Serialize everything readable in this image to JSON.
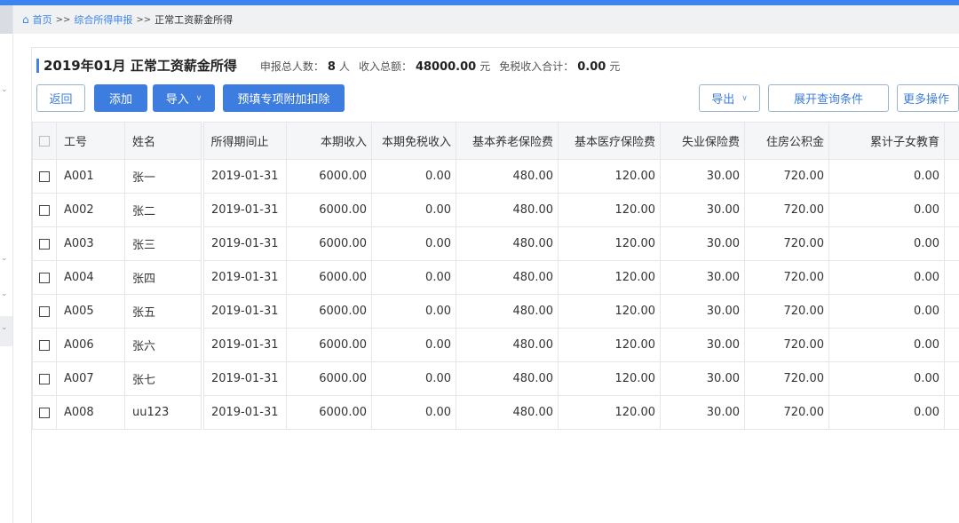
{
  "breadcrumb": {
    "home": "首页",
    "sep": ">>",
    "level2": "综合所得申报",
    "current": "正常工资薪金所得"
  },
  "header": {
    "title": "2019年01月 正常工资薪金所得",
    "count_label": "申报总人数：",
    "count": "8",
    "count_unit": "人",
    "income_label": "收入总额：",
    "income": "48000.00",
    "income_unit": "元",
    "taxfree_label": "免税收入合计：",
    "taxfree": "0.00",
    "taxfree_unit": "元"
  },
  "toolbar": {
    "back": "返回",
    "add": "添加",
    "import": "导入",
    "prefill": "预填专项附加扣除",
    "export": "导出",
    "expand_query": "展开查询条件",
    "more": "更多操作"
  },
  "table": {
    "columns": [
      "工号",
      "姓名",
      "所得期间止",
      "本期收入",
      "本期免税收入",
      "基本养老保险费",
      "基本医疗保险费",
      "失业保险费",
      "住房公积金",
      "累计子女教育"
    ],
    "rows": [
      [
        "A001",
        "张一",
        "2019-01-31",
        "6000.00",
        "0.00",
        "480.00",
        "120.00",
        "30.00",
        "720.00",
        "0.00"
      ],
      [
        "A002",
        "张二",
        "2019-01-31",
        "6000.00",
        "0.00",
        "480.00",
        "120.00",
        "30.00",
        "720.00",
        "0.00"
      ],
      [
        "A003",
        "张三",
        "2019-01-31",
        "6000.00",
        "0.00",
        "480.00",
        "120.00",
        "30.00",
        "720.00",
        "0.00"
      ],
      [
        "A004",
        "张四",
        "2019-01-31",
        "6000.00",
        "0.00",
        "480.00",
        "120.00",
        "30.00",
        "720.00",
        "0.00"
      ],
      [
        "A005",
        "张五",
        "2019-01-31",
        "6000.00",
        "0.00",
        "480.00",
        "120.00",
        "30.00",
        "720.00",
        "0.00"
      ],
      [
        "A006",
        "张六",
        "2019-01-31",
        "6000.00",
        "0.00",
        "480.00",
        "120.00",
        "30.00",
        "720.00",
        "0.00"
      ],
      [
        "A007",
        "张七",
        "2019-01-31",
        "6000.00",
        "0.00",
        "480.00",
        "120.00",
        "30.00",
        "720.00",
        "0.00"
      ],
      [
        "A008",
        "uu123",
        "2019-01-31",
        "6000.00",
        "0.00",
        "480.00",
        "120.00",
        "30.00",
        "720.00",
        "0.00"
      ]
    ]
  },
  "colors": {
    "accent": "#3d84ee",
    "button": "#3d7de0"
  }
}
